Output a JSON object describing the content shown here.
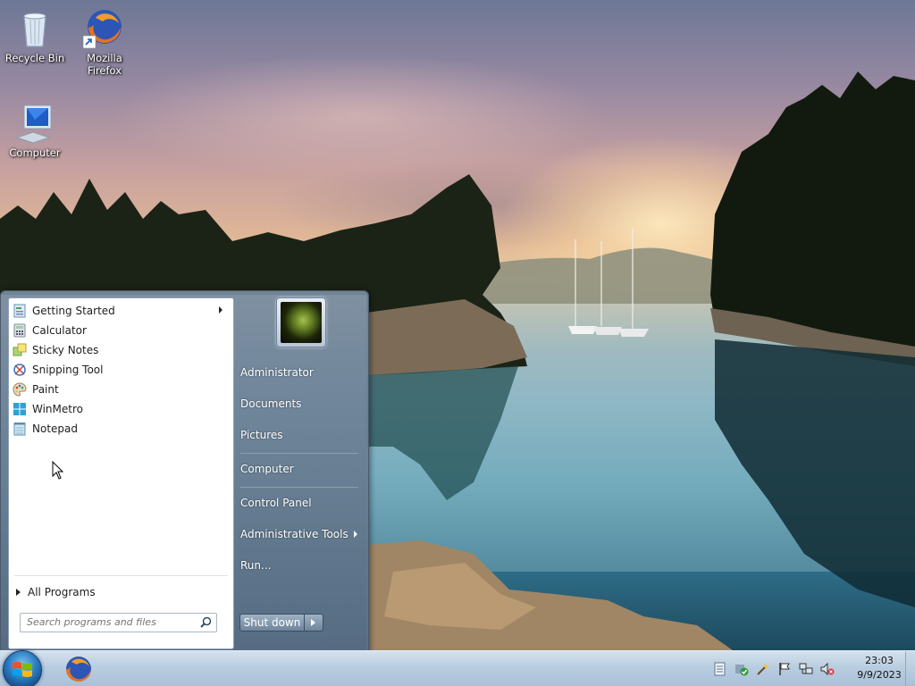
{
  "desktop": {
    "icons": [
      {
        "label": "Recycle Bin"
      },
      {
        "label": "Mozilla Firefox"
      },
      {
        "label": "Computer"
      }
    ]
  },
  "start_menu": {
    "programs": [
      {
        "label": "Getting Started",
        "icon": "getting-started-icon",
        "has_submenu": true
      },
      {
        "label": "Calculator",
        "icon": "calculator-icon"
      },
      {
        "label": "Sticky Notes",
        "icon": "sticky-notes-icon"
      },
      {
        "label": "Snipping Tool",
        "icon": "snipping-tool-icon"
      },
      {
        "label": "Paint",
        "icon": "paint-icon"
      },
      {
        "label": "WinMetro",
        "icon": "winmetro-icon"
      },
      {
        "label": "Notepad",
        "icon": "notepad-icon"
      }
    ],
    "all_programs": "All Programs",
    "search": {
      "placeholder": "Search programs and files"
    },
    "right": {
      "user": "Administrator",
      "documents": "Documents",
      "pictures": "Pictures",
      "computer": "Computer",
      "control_panel": "Control Panel",
      "admin_tools": "Administrative Tools",
      "run": "Run..."
    },
    "shutdown": "Shut down"
  },
  "taskbar": {
    "pinned": [
      "firefox-icon"
    ],
    "tray_icons": [
      "action-center-icon",
      "security-check-icon",
      "wand-icon",
      "flag-icon",
      "network-icon",
      "volume-muted-icon"
    ],
    "clock": {
      "time": "23:03",
      "date": "9/9/2023"
    }
  },
  "colors": {
    "taskbar": "#b9cde0",
    "start_menu_right": "#7a8ea4",
    "orb": "#2b7cc4"
  }
}
